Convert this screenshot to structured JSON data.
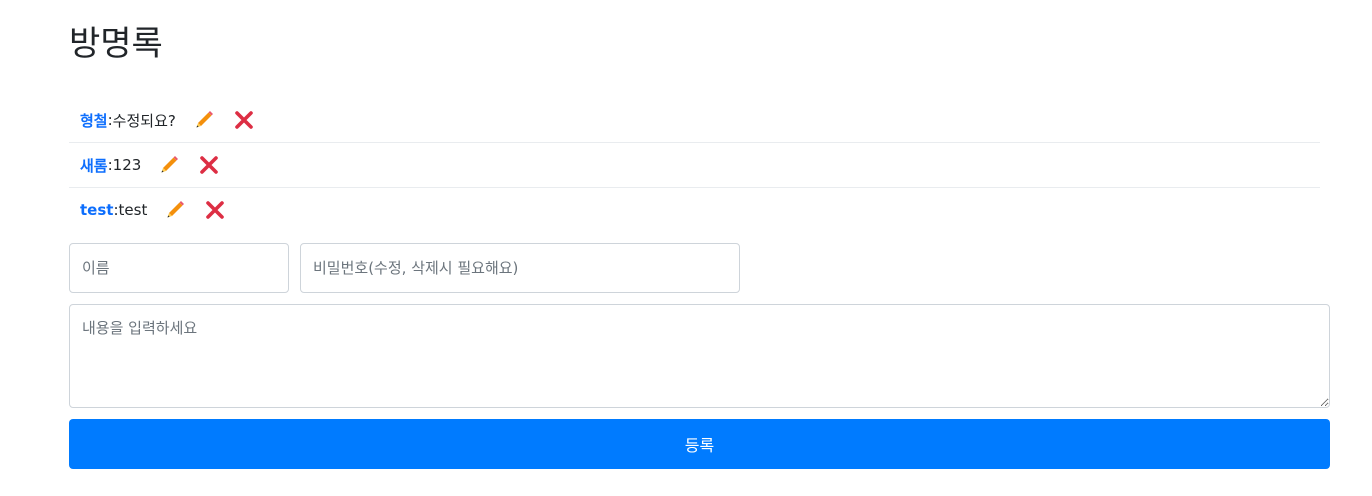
{
  "page": {
    "title": "방명록"
  },
  "entries": [
    {
      "name": "형철",
      "separator": ":",
      "content": "수정되요?"
    },
    {
      "name": "새롬",
      "separator": ":",
      "content": "123"
    },
    {
      "name": "test",
      "separator": ":",
      "content": "test"
    }
  ],
  "form": {
    "name_placeholder": "이름",
    "password_placeholder": "비밀번호(수정, 삭제시 필요해요)",
    "content_placeholder": "내용을 입력하세요",
    "submit_label": "등록"
  },
  "icons": {
    "edit": "pencil-icon",
    "delete": "close-icon"
  },
  "colors": {
    "name_link": "#0d6efd",
    "primary_button": "#007bff",
    "pencil_body": "#f4900c",
    "pencil_tip": "#ffcc4d",
    "delete_x": "#dd2e44"
  }
}
